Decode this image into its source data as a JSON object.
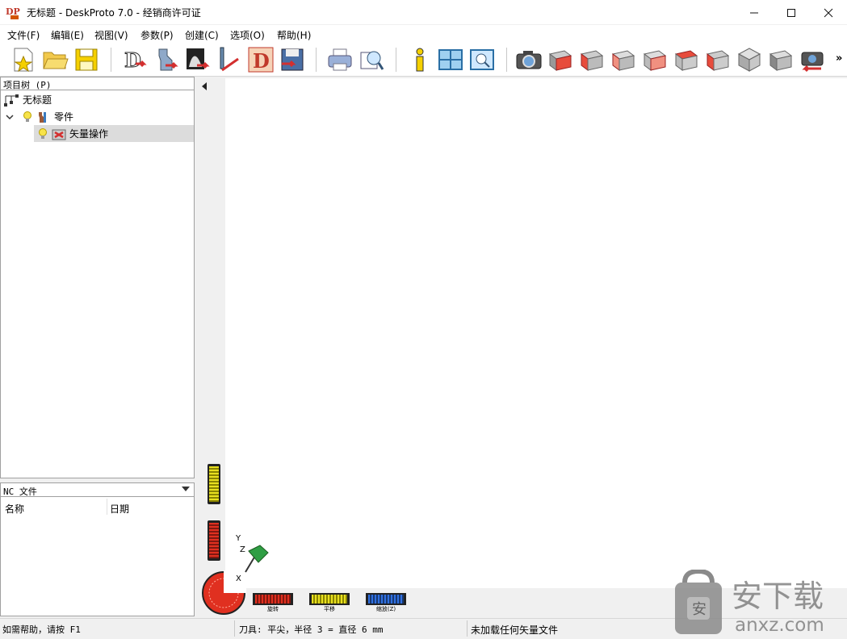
{
  "window": {
    "title": "无标题 - DeskProto 7.0 - 经销商许可证",
    "logo_text": "DP"
  },
  "menu": [
    {
      "label": "文件(F)"
    },
    {
      "label": "编辑(E)"
    },
    {
      "label": "视图(V)"
    },
    {
      "label": "参数(P)"
    },
    {
      "label": "创建(C)"
    },
    {
      "label": "选项(O)"
    },
    {
      "label": "帮助(H)"
    }
  ],
  "toolbar": {
    "icons": [
      "new-project-icon",
      "open-folder-icon",
      "save-disk-icon",
      "import-geometry-icon",
      "import-part-icon",
      "import-bitmap-icon",
      "import-vector-icon",
      "create-nc-icon",
      "save-nc-icon",
      "print-icon",
      "print-preview-icon",
      "info-icon",
      "split-view-icon",
      "list-view-icon",
      "camera-icon",
      "view-front-icon",
      "view-back-icon",
      "view-left-icon",
      "view-right-icon",
      "view-top-icon",
      "view-bottom-icon",
      "view-iso-icon",
      "view-shaded-icon",
      "camera-reset-icon"
    ],
    "overflow": "»"
  },
  "tree": {
    "header": "项目树 (P)",
    "root": "无标题",
    "part": "零件",
    "operation": "矢量操作"
  },
  "nc": {
    "header": "NC 文件",
    "columns": [
      "名称",
      "日期"
    ]
  },
  "view": {
    "axis_labels": {
      "y": "Y",
      "z": "Z",
      "x": "X"
    },
    "sliders": [
      {
        "label": "旋转",
        "color": "#e03020"
      },
      {
        "label": "平移",
        "color": "#e8e020"
      },
      {
        "label": "缩放(Z)",
        "color": "#3070e0"
      }
    ]
  },
  "status": {
    "help": "如需帮助，请按 F1",
    "tool": "刀具: 平尖，半径 3 = 直径 6 mm",
    "vector": "未加载任何矢量文件"
  },
  "watermark": {
    "text": "安下载",
    "url": "anxz.com"
  }
}
